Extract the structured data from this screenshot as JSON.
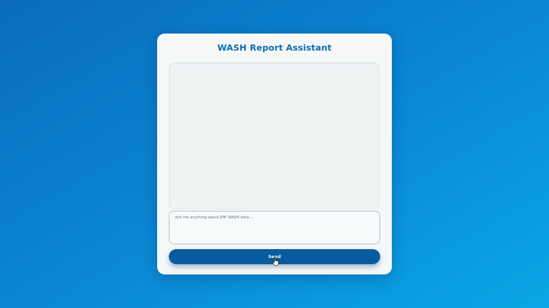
{
  "app": {
    "title": "WASH Report Assistant"
  },
  "chat": {
    "messages": []
  },
  "input": {
    "value": "",
    "placeholder": "Ask me anything about JMP WASH data..."
  },
  "actions": {
    "send_label": "Send"
  },
  "colors": {
    "accent": "#0b6fb5",
    "button": "#075b9e",
    "background_start": "#0a6cbd",
    "background_end": "#0aa6e6"
  }
}
